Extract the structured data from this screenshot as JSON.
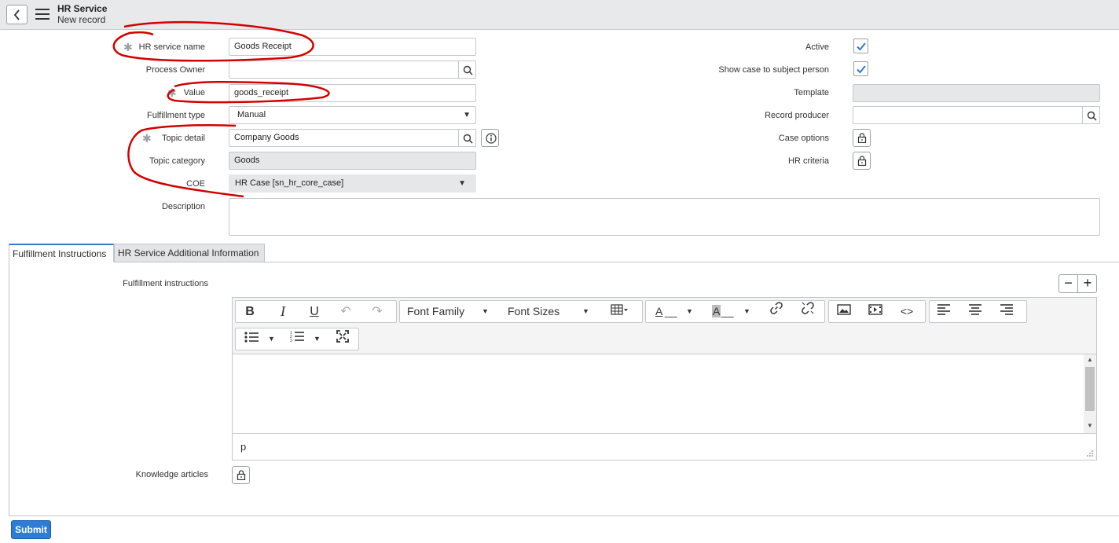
{
  "header": {
    "title": "HR Service",
    "subtitle": "New record"
  },
  "form": {
    "hr_service_name": {
      "label": "HR service name",
      "value": "Goods Receipt"
    },
    "process_owner": {
      "label": "Process Owner",
      "value": ""
    },
    "value": {
      "label": "Value",
      "value": "goods_receipt"
    },
    "fulfillment_type": {
      "label": "Fulfillment type",
      "value": "Manual"
    },
    "topic_detail": {
      "label": "Topic detail",
      "value": "Company Goods"
    },
    "topic_category": {
      "label": "Topic category",
      "value": "Goods"
    },
    "coe": {
      "label": "COE",
      "value": "HR Case [sn_hr_core_case]"
    },
    "description": {
      "label": "Description",
      "value": ""
    },
    "active": {
      "label": "Active",
      "checked": true
    },
    "show_case": {
      "label": "Show case to subject person",
      "checked": true
    },
    "template": {
      "label": "Template",
      "value": ""
    },
    "record_producer": {
      "label": "Record producer",
      "value": ""
    },
    "case_options": {
      "label": "Case options"
    },
    "hr_criteria": {
      "label": "HR criteria"
    }
  },
  "tabs": [
    {
      "label": "Fulfillment Instructions",
      "active": true
    },
    {
      "label": "HR Service Additional Information",
      "active": false
    }
  ],
  "fulfillment": {
    "label": "Fulfillment instructions",
    "toolbar": {
      "bold": "B",
      "italic": "I",
      "underline": "U",
      "font_family": "Font Family",
      "font_sizes": "Font Sizes",
      "text_color": "A",
      "bg_color": "A"
    },
    "status_path": "p"
  },
  "knowledge_articles": {
    "label": "Knowledge articles"
  },
  "submit_label": "Submit",
  "colors": {
    "accent": "#2e7cd6",
    "annotation": "#d40000"
  },
  "icons": [
    "back-icon",
    "menu-icon",
    "search-icon",
    "info-icon",
    "lock-icon",
    "check-icon"
  ]
}
